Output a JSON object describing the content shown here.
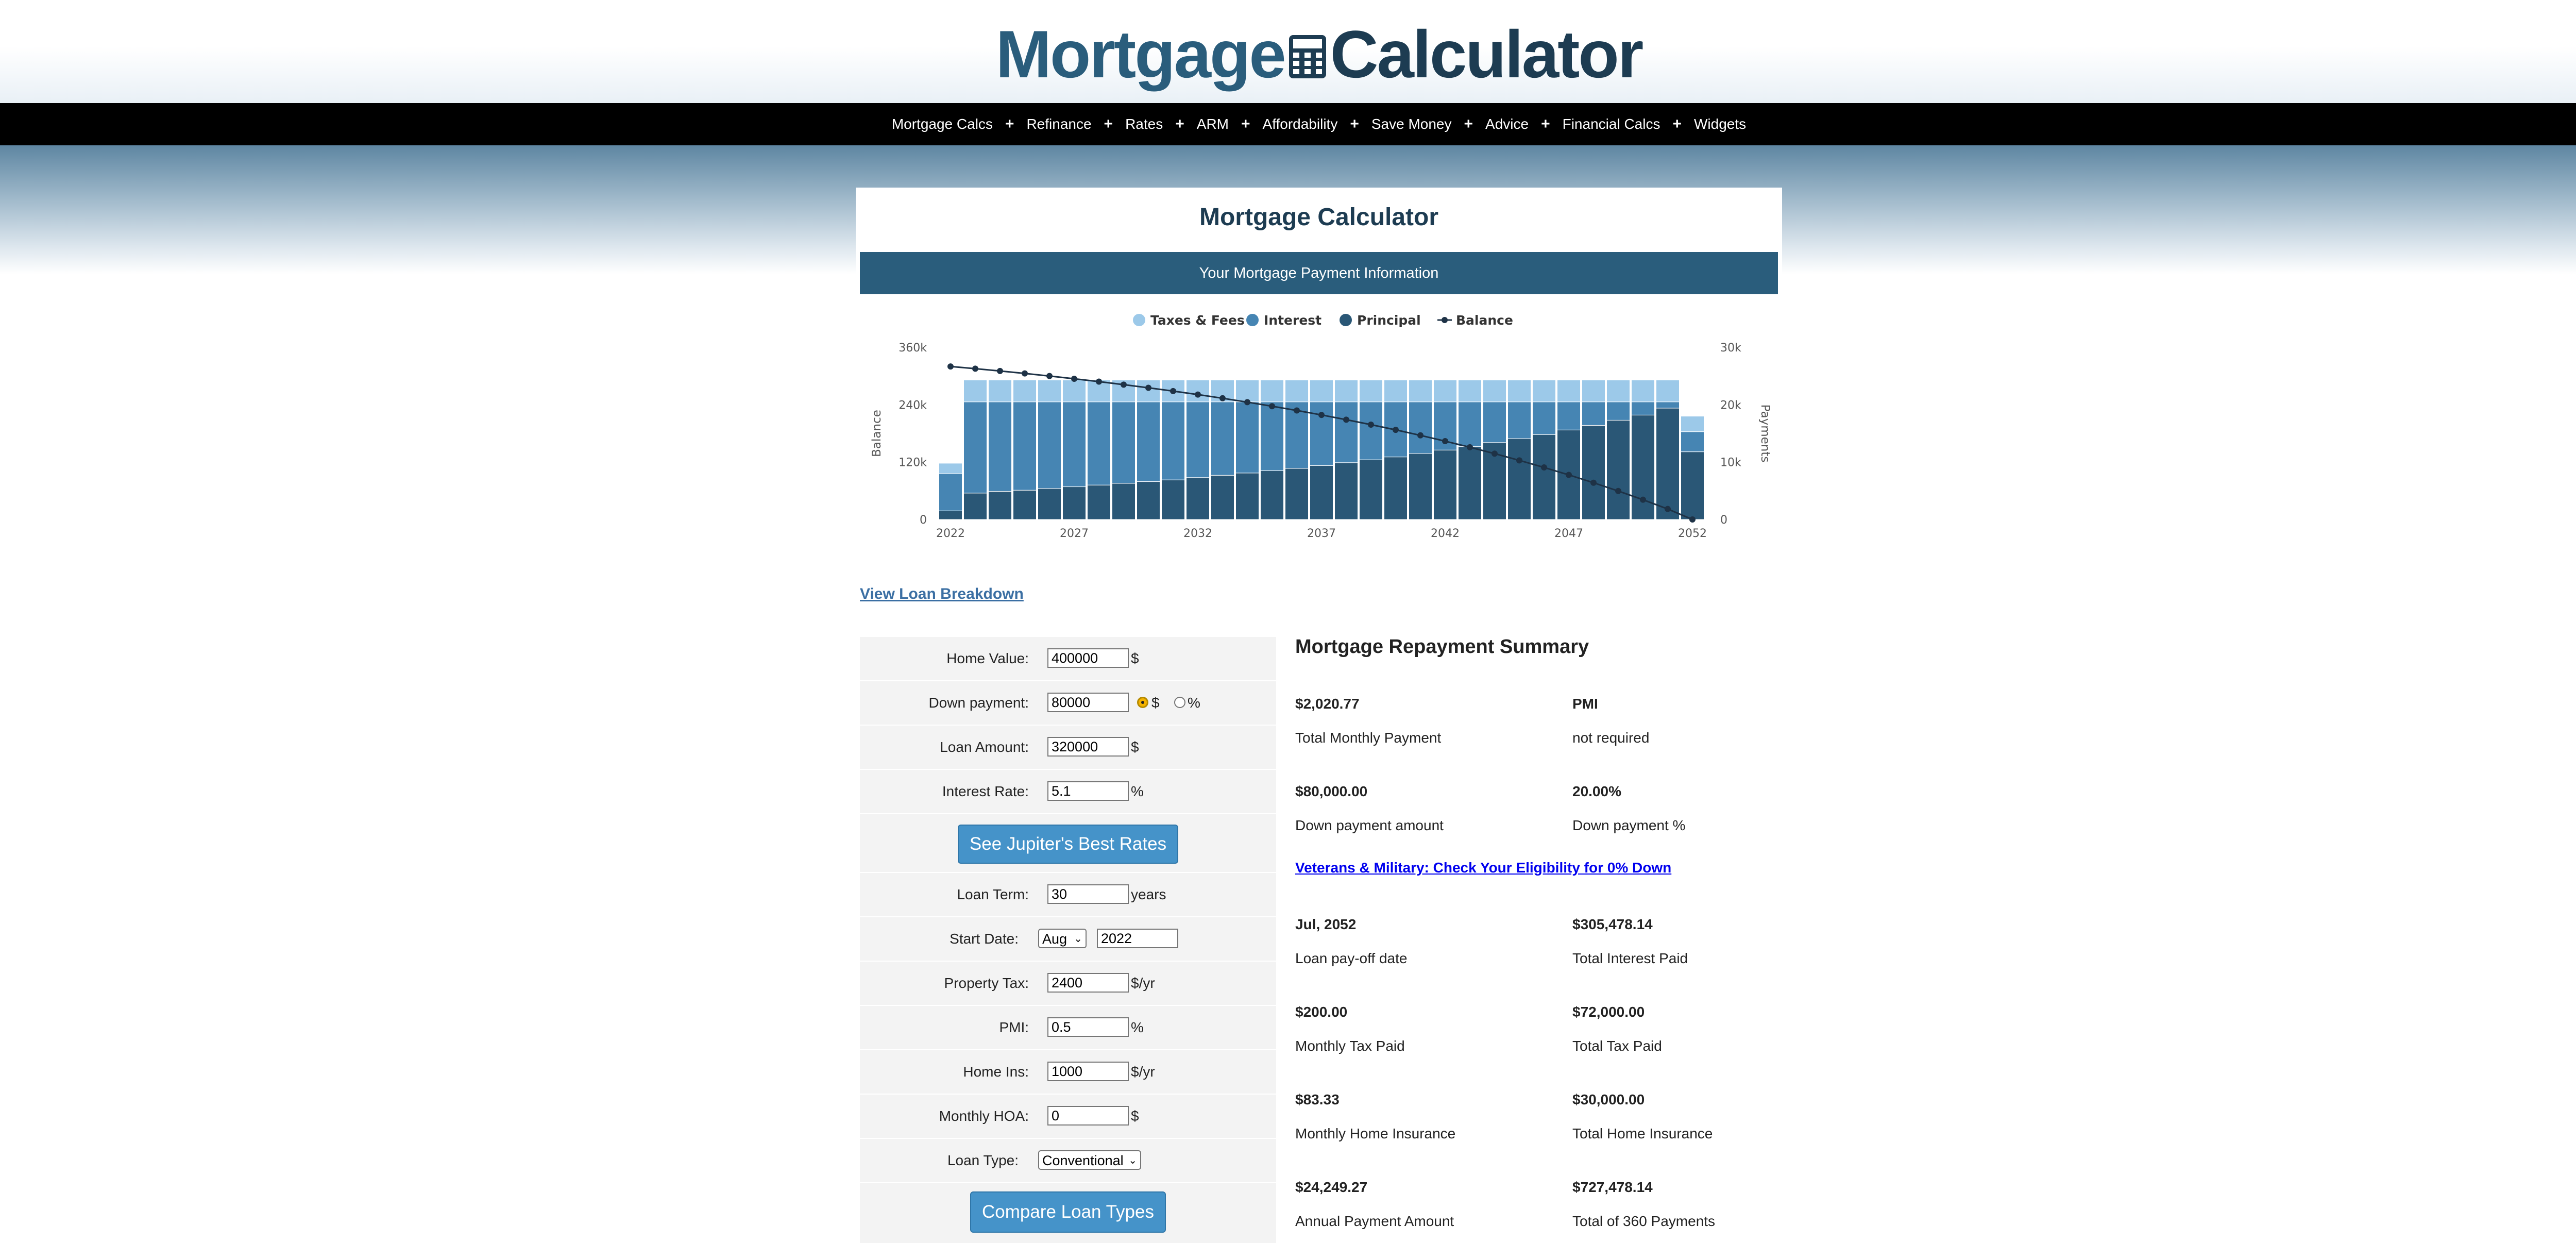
{
  "logo": {
    "word1": "Mortgage",
    "word2": "Calculator"
  },
  "nav": [
    "Mortgage Calcs",
    "Refinance",
    "Rates",
    "ARM",
    "Affordability",
    "Save Money",
    "Advice",
    "Financial Calcs",
    "Widgets"
  ],
  "nav_separator": "+",
  "page_title": "Mortgage Calculator",
  "info_bar": "Your Mortgage Payment Information",
  "view_breakdown": "View Loan Breakdown",
  "chart_data": {
    "type": "bar",
    "stacked": true,
    "legend": [
      "Taxes & Fees",
      "Interest",
      "Principal",
      "Balance"
    ],
    "legend_position": "top-center",
    "left_axis": {
      "label": "Balance",
      "ticks": [
        "360k",
        "240k",
        "120k",
        "0"
      ],
      "range": [
        0,
        360000
      ]
    },
    "right_axis": {
      "label": "Payments",
      "ticks": [
        "30k",
        "20k",
        "10k",
        "0"
      ],
      "range": [
        0,
        30000
      ]
    },
    "x_ticks": [
      "2022",
      "2027",
      "2032",
      "2037",
      "2042",
      "2047",
      "2052"
    ],
    "years": [
      2022,
      2023,
      2024,
      2025,
      2026,
      2027,
      2028,
      2029,
      2030,
      2031,
      2032,
      2033,
      2034,
      2035,
      2036,
      2037,
      2038,
      2039,
      2040,
      2041,
      2042,
      2043,
      2044,
      2045,
      2046,
      2047,
      2048,
      2049,
      2050,
      2051,
      2052
    ],
    "colors": {
      "taxes": "#9cc9e9",
      "interest": "#4685b3",
      "principal": "#2a5776",
      "balance": "#1e3246"
    },
    "series": [
      {
        "name": "Principal",
        "values": [
          1500,
          4600,
          4900,
          5100,
          5400,
          5700,
          6000,
          6300,
          6600,
          6900,
          7300,
          7700,
          8100,
          8500,
          8900,
          9400,
          9900,
          10400,
          10900,
          11500,
          12100,
          12700,
          13400,
          14100,
          14800,
          15600,
          16400,
          17300,
          18200,
          19400,
          11800
        ]
      },
      {
        "name": "Interest",
        "values": [
          6500,
          15900,
          15600,
          15400,
          15100,
          14800,
          14500,
          14200,
          13900,
          13600,
          13200,
          12800,
          12400,
          12000,
          11600,
          11100,
          10600,
          10100,
          9600,
          9000,
          8400,
          7800,
          7100,
          6400,
          5700,
          4900,
          4100,
          3200,
          2300,
          1100,
          3500
        ]
      },
      {
        "name": "Taxes & Fees",
        "values": [
          1800,
          3800,
          3800,
          3800,
          3800,
          3800,
          3800,
          3800,
          3800,
          3800,
          3800,
          3800,
          3800,
          3800,
          3800,
          3800,
          3800,
          3800,
          3800,
          3800,
          3800,
          3800,
          3800,
          3800,
          3800,
          3800,
          3800,
          3800,
          3800,
          3800,
          2700
        ]
      },
      {
        "name": "Balance",
        "values": [
          320000,
          315400,
          310500,
          305400,
          300000,
          294300,
          288300,
          282000,
          275400,
          268500,
          261200,
          253500,
          245400,
          236900,
          228000,
          218600,
          208700,
          198300,
          187400,
          175900,
          163800,
          151100,
          137700,
          123600,
          108800,
          93200,
          76800,
          59500,
          41300,
          21900,
          0
        ]
      }
    ]
  },
  "form": {
    "home_value": {
      "label": "Home Value:",
      "value": "400000",
      "unit": "$"
    },
    "down_payment": {
      "label": "Down payment:",
      "value": "80000",
      "opt1": "$",
      "opt2": "%"
    },
    "loan_amount": {
      "label": "Loan Amount:",
      "value": "320000",
      "unit": "$"
    },
    "interest_rate": {
      "label": "Interest Rate:",
      "value": "5.1",
      "unit": "%"
    },
    "rates_button": "See Jupiter's Best Rates",
    "loan_term": {
      "label": "Loan Term:",
      "value": "30",
      "unit": "years"
    },
    "start_date": {
      "label": "Start Date:",
      "month": "Aug",
      "year": "2022"
    },
    "property_tax": {
      "label": "Property Tax:",
      "value": "2400",
      "unit": "$/yr"
    },
    "pmi": {
      "label": "PMI:",
      "value": "0.5",
      "unit": "%"
    },
    "home_ins": {
      "label": "Home Ins:",
      "value": "1000",
      "unit": "$/yr"
    },
    "monthly_hoa": {
      "label": "Monthly HOA:",
      "value": "0",
      "unit": "$"
    },
    "loan_type": {
      "label": "Loan Type:",
      "value": "Conventional"
    },
    "compare_button": "Compare Loan Types"
  },
  "summary": {
    "title": "Mortgage Repayment Summary",
    "items": [
      {
        "value": "$2,020.77",
        "label": "Total Monthly Payment"
      },
      {
        "value": "PMI",
        "label": "not required"
      },
      {
        "value": "$80,000.00",
        "label": "Down payment amount"
      },
      {
        "value": "20.00%",
        "label": "Down payment %"
      },
      {
        "value": "Jul, 2052",
        "label": "Loan pay-off date"
      },
      {
        "value": "$305,478.14",
        "label": "Total Interest Paid"
      },
      {
        "value": "$200.00",
        "label": "Monthly Tax Paid"
      },
      {
        "value": "$72,000.00",
        "label": "Total Tax Paid"
      },
      {
        "value": "$83.33",
        "label": "Monthly Home Insurance"
      },
      {
        "value": "$30,000.00",
        "label": "Total Home Insurance"
      },
      {
        "value": "$24,249.27",
        "label": "Annual Payment Amount"
      },
      {
        "value": "$727,478.14",
        "label": "Total of 360 Payments"
      }
    ],
    "veterans_link": "Veterans & Military: Check Your Eligibility for 0% Down"
  }
}
